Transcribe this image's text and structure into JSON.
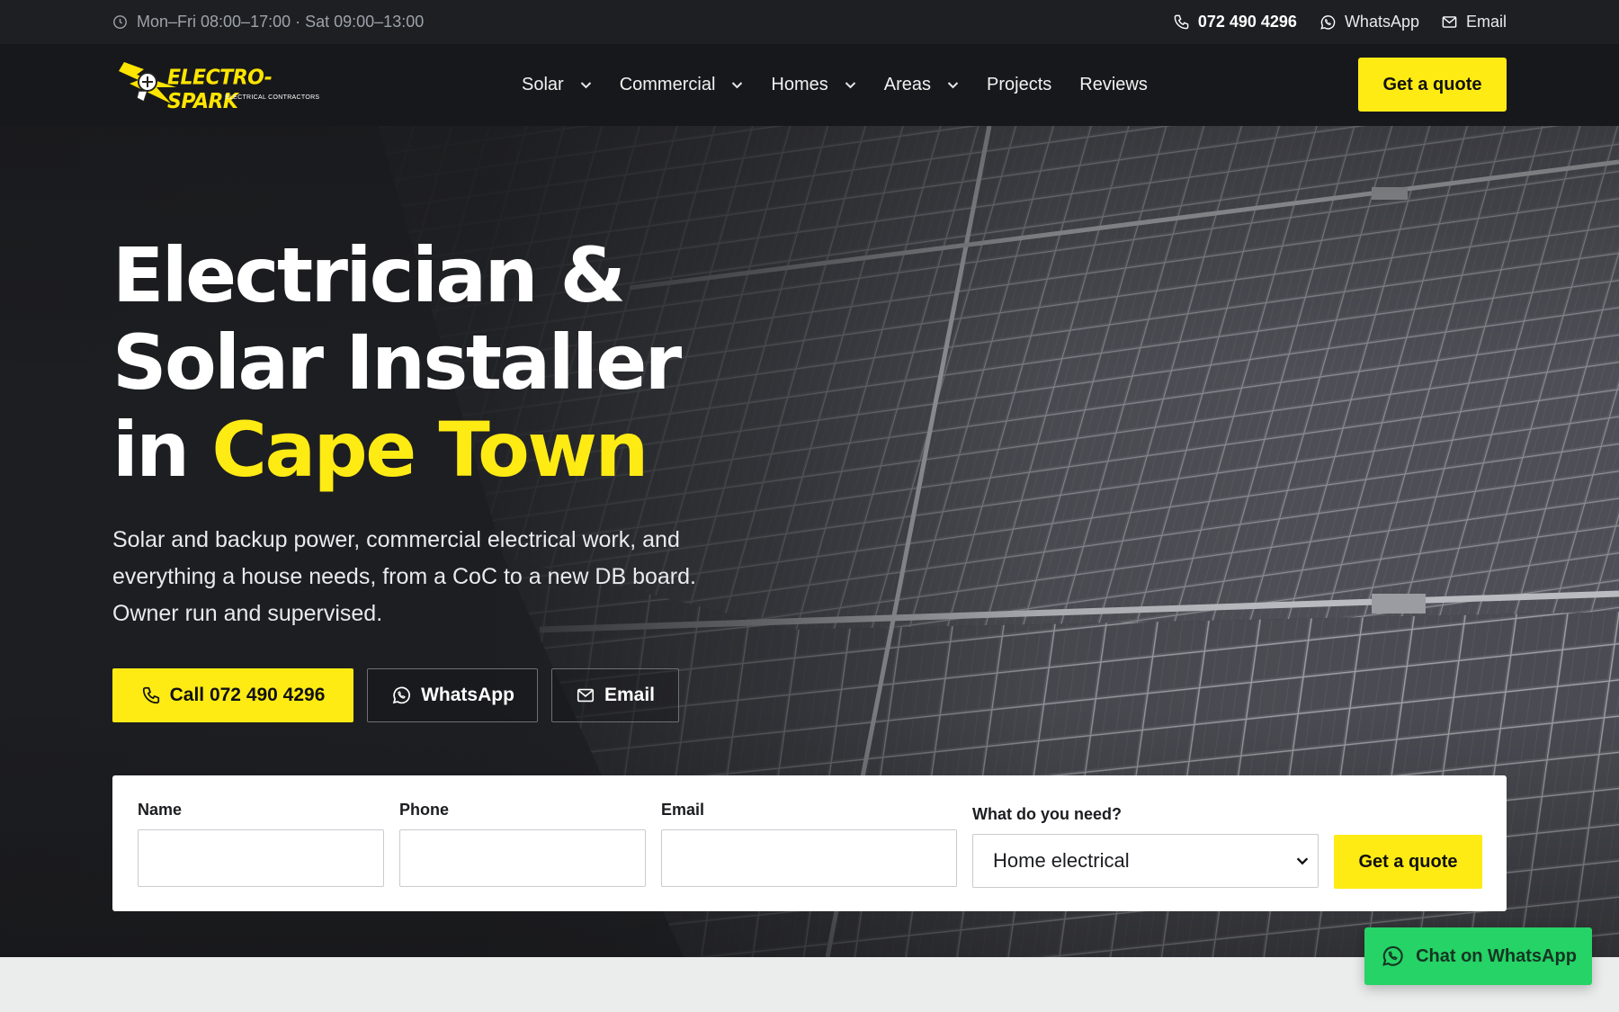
{
  "topbar": {
    "hours": "Mon–Fri 08:00–17:00 · Sat 09:00–13:00",
    "phone": "072 490 4296",
    "whatsapp": "WhatsApp",
    "email": "Email"
  },
  "brand": {
    "name": "ELECTRO-SPARK",
    "tagline": "ELECTRICAL CONTRACTORS",
    "accent": "#ffeb14"
  },
  "nav": {
    "items": [
      {
        "label": "Solar",
        "dropdown": true
      },
      {
        "label": "Commercial",
        "dropdown": true
      },
      {
        "label": "Homes",
        "dropdown": true
      },
      {
        "label": "Areas",
        "dropdown": true
      },
      {
        "label": "Projects",
        "dropdown": false
      },
      {
        "label": "Reviews",
        "dropdown": false
      }
    ],
    "cta": "Get a quote"
  },
  "hero": {
    "line1": "Electrician &",
    "line2": "Solar Installer",
    "line3_prefix": "in",
    "line3_highlight": "Cape Town",
    "lede": "Solar and backup power, commercial electrical work, and everything a house needs, from a CoC to a new DB board. Owner run and supervised.",
    "call_label": "Call 072 490 4296",
    "whatsapp_label": "WhatsApp",
    "email_label": "Email"
  },
  "quote_form": {
    "name_label": "Name",
    "name_value": "",
    "phone_label": "Phone",
    "phone_value": "",
    "email_label": "Email",
    "email_value": "",
    "need_label": "What do you need?",
    "need_selected": "Home electrical",
    "submit_label": "Get a quote"
  },
  "floating_chat": {
    "label": "Chat on WhatsApp",
    "color": "#25d366"
  }
}
